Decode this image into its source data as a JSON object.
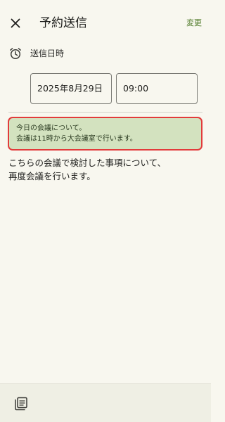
{
  "header": {
    "close_icon": "close-icon",
    "title": "予約送信",
    "change_label": "変更"
  },
  "schedule": {
    "icon": "alarm-clock-icon",
    "label": "送信日時",
    "date": "2025年8月29日",
    "time": "09:00"
  },
  "quote": {
    "line1": "今日の会議について。",
    "line2": "会議は11時から大会議室で行います。",
    "border_color": "#e23b3b",
    "background": "#d3e2bf"
  },
  "message": {
    "line1": "こちらの会議で検討した事項について、",
    "line2": "再度会議を行います。"
  },
  "bottom_bar": {
    "template_icon": "template-stack-icon"
  },
  "colors": {
    "accent": "#4f7a28",
    "background": "#f8f7ef"
  }
}
